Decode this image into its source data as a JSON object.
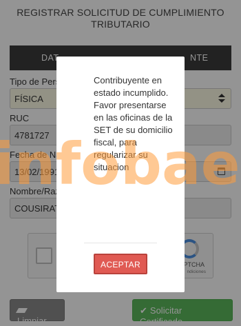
{
  "header": {
    "title_line1": "REGISTRAR SOLICITUD DE CUMPLIMIENTO",
    "title_line2": "TRIBUTARIO"
  },
  "tabs": {
    "left_label": "DAT",
    "right_label": "NTE"
  },
  "form": {
    "tipo_label": "Tipo de Perso",
    "tipo_value": "FÍSICA",
    "ruc_label": "RUC",
    "ruc_value": "4781727",
    "fecha_label": "Fecha de Nac",
    "fecha_value": "13/02/1991",
    "nombre_label": "Nombre/Raz",
    "nombre_value": "COUSIRAT J"
  },
  "captcha": {
    "brand": "APTCHA",
    "terms": "ndiciones"
  },
  "buttons": {
    "clear_label": "Limpiar",
    "certificate_label": "Solicitar Certificado"
  },
  "modal": {
    "message": "Contribuyente en estado incumplido. Favor presentarse en las oficinas de la SET de su domicilio fiscal, para regularizar su situacion",
    "accept_label": "ACEPTAR"
  },
  "watermark": {
    "text": "infobae"
  },
  "colors": {
    "accept": "#e05a53",
    "success": "#5cb85c",
    "watermark": "#ff9c3c"
  }
}
